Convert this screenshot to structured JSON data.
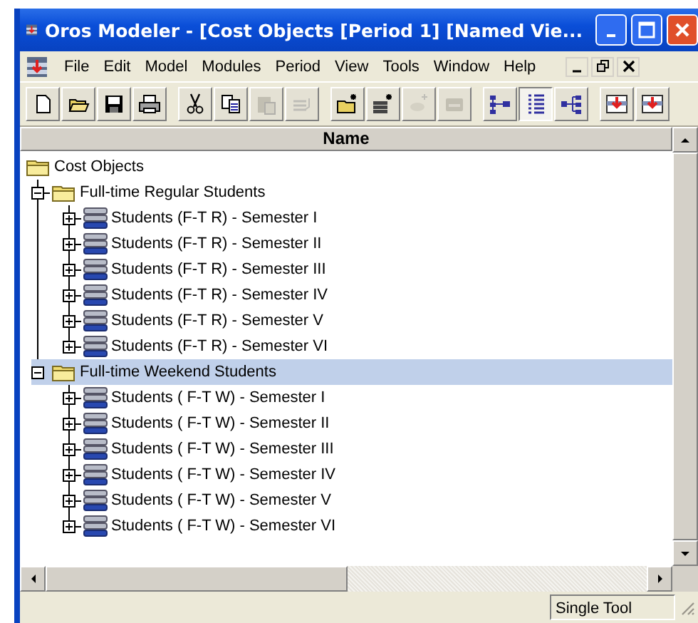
{
  "window": {
    "title": "Oros Modeler - [Cost Objects [Period 1] [Named Vie..."
  },
  "menu": [
    {
      "label": "File"
    },
    {
      "label": "Edit"
    },
    {
      "label": "Model"
    },
    {
      "label": "Modules"
    },
    {
      "label": "Period"
    },
    {
      "label": "View"
    },
    {
      "label": "Tools"
    },
    {
      "label": "Window"
    },
    {
      "label": "Help"
    }
  ],
  "toolbar": [
    [
      {
        "kind": "new",
        "disabled": false,
        "pressed": false
      },
      {
        "kind": "open",
        "disabled": false,
        "pressed": false
      },
      {
        "kind": "save",
        "disabled": false,
        "pressed": false
      },
      {
        "kind": "print",
        "disabled": false,
        "pressed": false
      }
    ],
    [
      {
        "kind": "cut",
        "disabled": false,
        "pressed": false
      },
      {
        "kind": "copy",
        "disabled": false,
        "pressed": false
      },
      {
        "kind": "paste",
        "disabled": true,
        "pressed": false
      },
      {
        "kind": "insert",
        "disabled": true,
        "pressed": false
      }
    ],
    [
      {
        "kind": "new-folder",
        "disabled": false,
        "pressed": false
      },
      {
        "kind": "new-object",
        "disabled": false,
        "pressed": false
      },
      {
        "kind": "new-item",
        "disabled": true,
        "pressed": false
      },
      {
        "kind": "card",
        "disabled": true,
        "pressed": false
      }
    ],
    [
      {
        "kind": "tree",
        "disabled": false,
        "pressed": false
      },
      {
        "kind": "list",
        "disabled": false,
        "pressed": true
      },
      {
        "kind": "tree-right",
        "disabled": false,
        "pressed": false
      }
    ],
    [
      {
        "kind": "module",
        "disabled": false,
        "pressed": false
      },
      {
        "kind": "module",
        "disabled": false,
        "pressed": false
      }
    ]
  ],
  "tree": {
    "header": "Name",
    "nodes": [
      {
        "label": "Cost Objects",
        "kind": "root",
        "selected": false,
        "children": [
          {
            "label": "Full-time Regular Students",
            "kind": "folder",
            "expanded": true,
            "selected": false,
            "children": [
              {
                "label": "Students (F-T R) - Semester I",
                "kind": "object",
                "expanded": false,
                "selected": false
              },
              {
                "label": "Students (F-T R) - Semester II",
                "kind": "object",
                "expanded": false,
                "selected": false
              },
              {
                "label": "Students (F-T R) - Semester III",
                "kind": "object",
                "expanded": false,
                "selected": false
              },
              {
                "label": "Students (F-T R) - Semester IV",
                "kind": "object",
                "expanded": false,
                "selected": false
              },
              {
                "label": "Students (F-T R) - Semester V",
                "kind": "object",
                "expanded": false,
                "selected": false
              },
              {
                "label": "Students (F-T R) - Semester VI",
                "kind": "object",
                "expanded": false,
                "selected": false
              }
            ]
          },
          {
            "label": "Full-time Weekend Students",
            "kind": "folder",
            "expanded": true,
            "selected": true,
            "children": [
              {
                "label": "Students ( F-T W) - Semester I",
                "kind": "object",
                "expanded": false,
                "selected": false
              },
              {
                "label": "Students ( F-T W) - Semester II",
                "kind": "object",
                "expanded": false,
                "selected": false
              },
              {
                "label": "Students ( F-T W) - Semester III",
                "kind": "object",
                "expanded": false,
                "selected": false
              },
              {
                "label": "Students ( F-T W) - Semester IV",
                "kind": "object",
                "expanded": false,
                "selected": false
              },
              {
                "label": "Students ( F-T W) - Semester V",
                "kind": "object",
                "expanded": false,
                "selected": false
              },
              {
                "label": "Students ( F-T W) - Semester VI",
                "kind": "object",
                "expanded": false,
                "selected": false
              }
            ]
          }
        ]
      }
    ]
  },
  "status_bar": {
    "panel": "Single Tool"
  }
}
